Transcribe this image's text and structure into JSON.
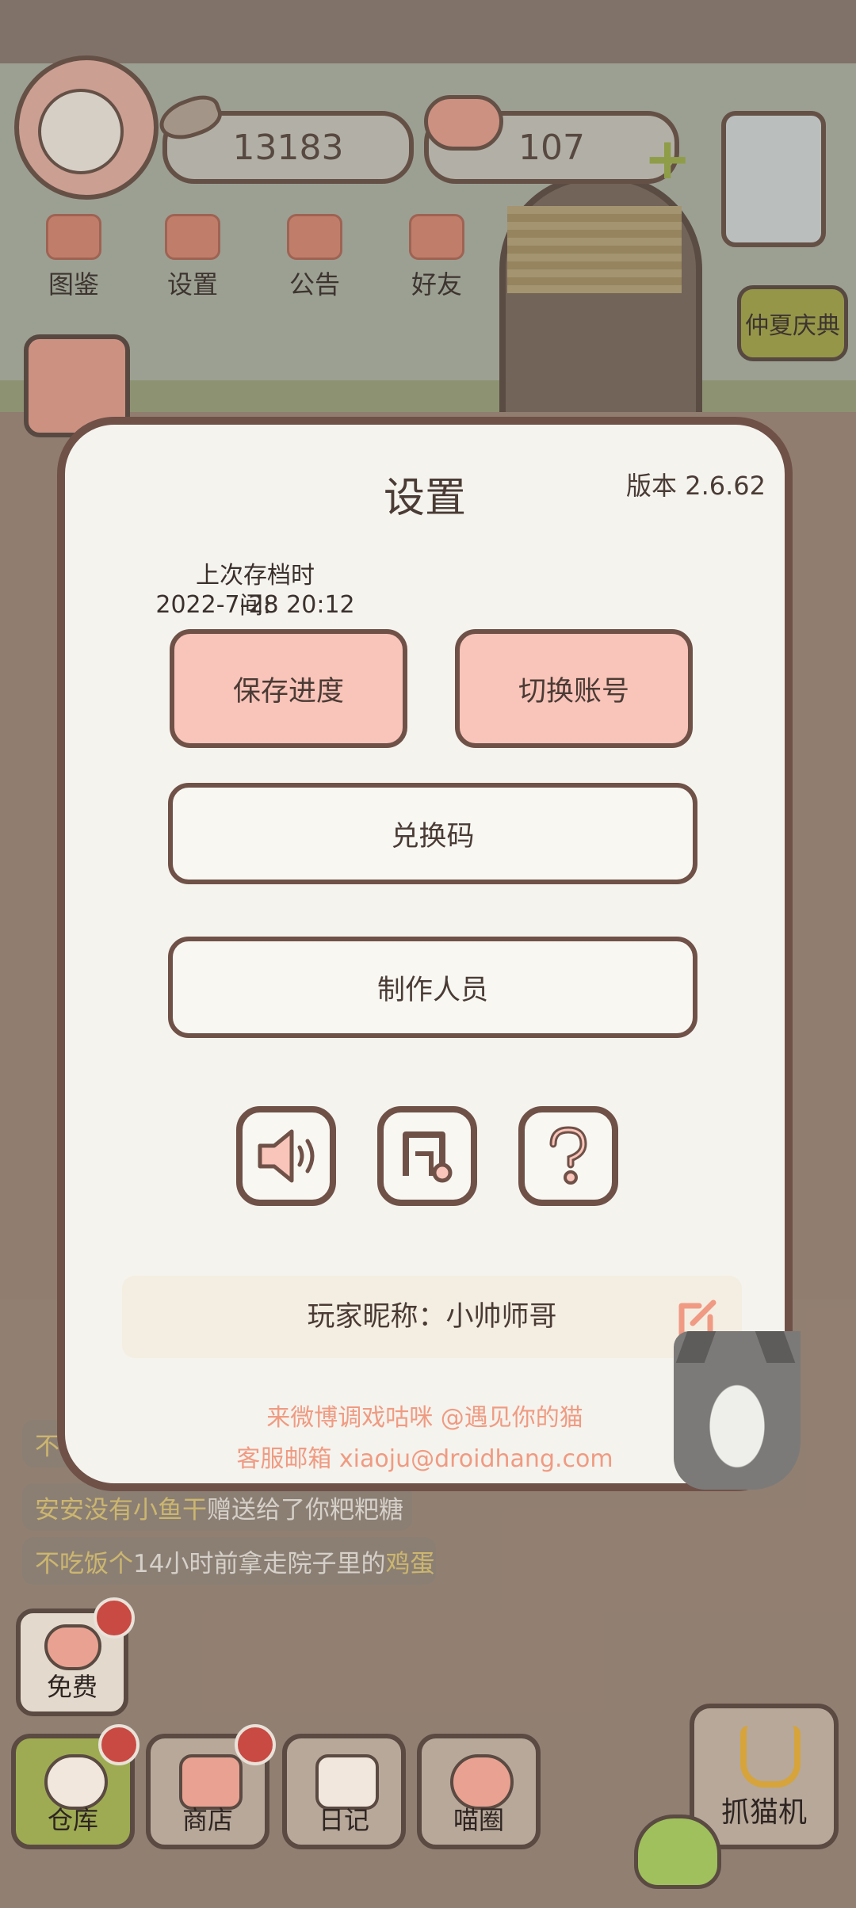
{
  "hud": {
    "fish_count": "13183",
    "heart_count": "107",
    "menu": [
      {
        "label": "图鉴",
        "icon": "cat-head-icon"
      },
      {
        "label": "设置",
        "icon": "gear-icon"
      },
      {
        "label": "公告",
        "icon": "gift-icon"
      },
      {
        "label": "好友",
        "icon": "friends-icon"
      }
    ],
    "event_label": "仲夏庆典"
  },
  "feed": [
    {
      "highlight": "不",
      "text": ""
    },
    {
      "highlight": "安安没有小鱼干",
      "text": "赠送给了你粑粑糖"
    },
    {
      "highlight": "不吃饭个",
      "text": "14小时前拿走院子里的",
      "highlight2": "鸡蛋"
    }
  ],
  "settings": {
    "title": "设置",
    "version": "版本 2.6.62",
    "last_save_label": "上次存档时间:",
    "last_save_time": "2022-7-28 20:12",
    "save_button": "保存进度",
    "switch_button": "切换账号",
    "redeem_button": "兑换码",
    "credits_button": "制作人员",
    "icon_buttons": [
      "speaker-icon",
      "music-icon",
      "question-icon"
    ],
    "nickname_label": "玩家昵称：小帅师哥",
    "weibo_line": "来微博调戏咕咪 @遇见你的猫",
    "email_line": "客服邮箱 xiaoju@droidhang.com"
  },
  "bottom": {
    "free_label": "免费",
    "tabs": [
      {
        "label": "仓库",
        "icon": "storage-icon"
      },
      {
        "label": "商店",
        "icon": "shop-icon"
      },
      {
        "label": "日记",
        "icon": "diary-icon"
      },
      {
        "label": "喵圈",
        "icon": "cat-planet-icon"
      }
    ],
    "claw_label": "抓猫机"
  },
  "colors": {
    "dialog_bg": "#f5f3ee",
    "dialog_border": "#6f5148",
    "pink_button": "#f9c4b9",
    "link_text": "#ef9b82"
  }
}
